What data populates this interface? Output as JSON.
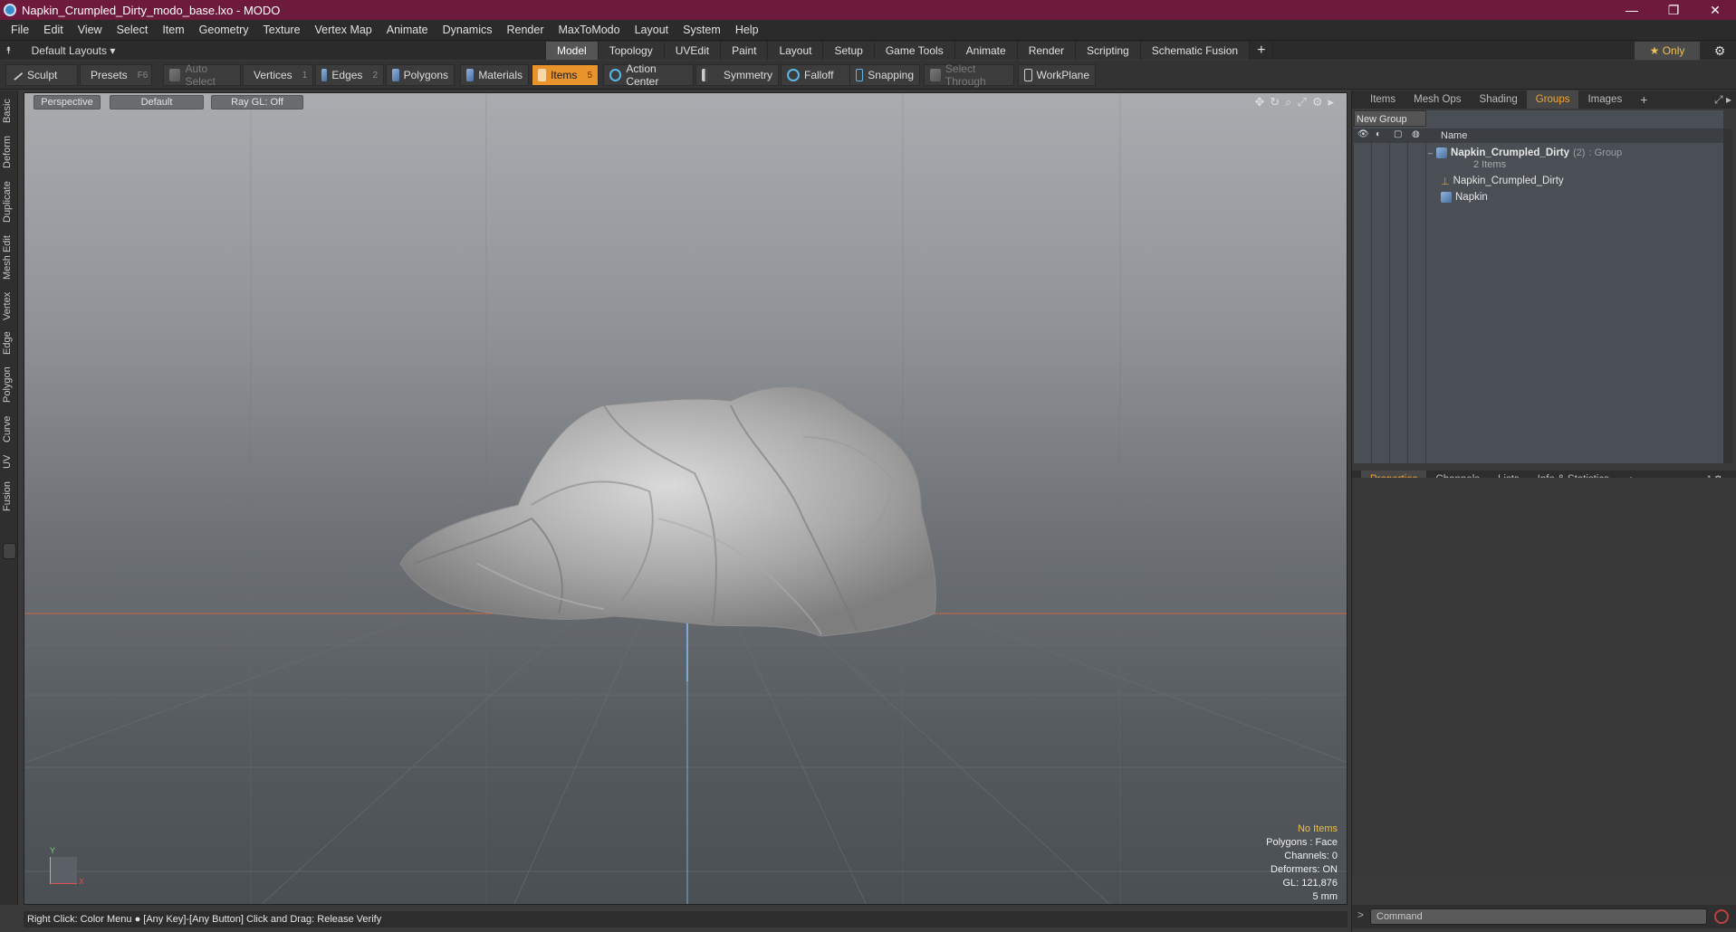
{
  "window": {
    "title": "Napkin_Crumpled_Dirty_modo_base.lxo - MODO",
    "controls": [
      "—",
      "❐",
      "✕"
    ]
  },
  "menu": [
    "File",
    "Edit",
    "View",
    "Select",
    "Item",
    "Geometry",
    "Texture",
    "Vertex Map",
    "Animate",
    "Dynamics",
    "Render",
    "MaxToModo",
    "Layout",
    "System",
    "Help"
  ],
  "layout_bar": {
    "layout_menu": "Default Layouts ▾",
    "tabs": [
      "Model",
      "Topology",
      "UVEdit",
      "Paint",
      "Layout",
      "Setup",
      "Game Tools",
      "Animate",
      "Render",
      "Scripting",
      "Schematic Fusion",
      "+"
    ],
    "active_tab": "Model",
    "only_label": "★  Only"
  },
  "toolbar": {
    "sculpt": "Sculpt",
    "presets": "Presets",
    "presets_hotkey": "F6",
    "auto_select": "Auto Select",
    "vertices": "Vertices",
    "vertices_hotkey": "1",
    "edges": "Edges",
    "edges_hotkey": "2",
    "polygons": "Polygons",
    "materials": "Materials",
    "items": "Items",
    "items_hotkey": "5",
    "action_center": "Action Center",
    "symmetry": "Symmetry",
    "falloff": "Falloff",
    "snapping": "Snapping",
    "select_through": "Select Through",
    "workplane": "WorkPlane"
  },
  "left_tabs": [
    "Basic",
    "Deform",
    "Duplicate",
    "Mesh Edit",
    "Vertex",
    "Edge",
    "Polygon",
    "Curve",
    "UV",
    "Fusion"
  ],
  "viewport": {
    "view": "Perspective",
    "shading": "Default",
    "raygl": "Ray GL: Off",
    "stats": {
      "selection": "No Items",
      "polygons": "Polygons : Face",
      "channels": "Channels: 0",
      "deformers": "Deformers: ON",
      "gl": "GL: 121,876",
      "unit": "5 mm"
    },
    "axis": {
      "y": "Y",
      "x": "X"
    }
  },
  "status": "Right Click: Color Menu ● [Any Key]-[Any Button] Click and Drag: Release Verify",
  "right_panel": {
    "top_tabs": [
      "Items",
      "Mesh Ops",
      "Shading",
      "Groups",
      "Images",
      "+"
    ],
    "active_top_tab": "Groups",
    "new_group": "New Group",
    "column_name": "Name",
    "group": {
      "name": "Napkin_Crumpled_Dirty",
      "count": "(2)",
      "type": ": Group",
      "sub": "2 Items"
    },
    "children": [
      "Napkin_Crumpled_Dirty",
      "Napkin"
    ],
    "bottom_tabs": [
      "Properties",
      "Channels",
      "Lists",
      "Info & Statistics",
      "+"
    ],
    "active_bottom_tab": "Properties",
    "command_placeholder": "Command"
  }
}
